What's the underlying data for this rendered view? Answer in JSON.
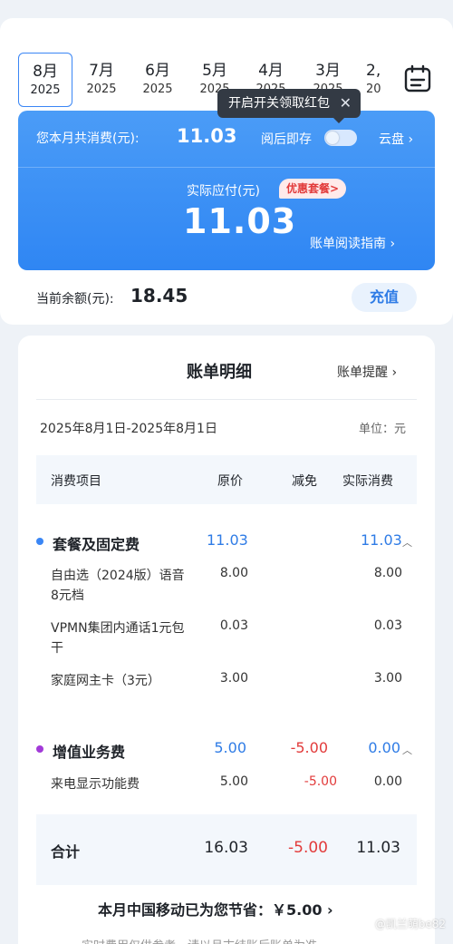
{
  "months": [
    {
      "month": "8月",
      "year": "2025",
      "active": true
    },
    {
      "month": "7月",
      "year": "2025"
    },
    {
      "month": "6月",
      "year": "2025"
    },
    {
      "month": "5月",
      "year": "2025"
    },
    {
      "month": "4月",
      "year": "2025"
    },
    {
      "month": "3月",
      "year": "2025"
    },
    {
      "month": "2,",
      "year": "20"
    }
  ],
  "tooltip": {
    "text": "开启开关领取红包",
    "close": "✕"
  },
  "hero": {
    "month_total_label": "您本月共消费(元):",
    "month_total_value": "11.03",
    "post_read_label": "阅后即存",
    "cloud_label": "云盘 ›",
    "actual_pay_label": "实际应付(元)",
    "promo_badge": "优惠套餐>",
    "actual_pay_value": "11.03",
    "guide_link": "账单阅读指南 ›"
  },
  "balance": {
    "label": "当前余额(元):",
    "value": "18.45",
    "recharge": "充值"
  },
  "detail": {
    "title": "账单明细",
    "remind": "账单提醒 ›",
    "range": "2025年8月1日-2025年8月1日",
    "unit": "单位：元",
    "headers": {
      "item": "消费项目",
      "original": "原价",
      "discount": "减免",
      "actual": "实际消费"
    },
    "groups": [
      {
        "name": "套餐及固定费",
        "original": "11.03",
        "discount": "",
        "actual": "11.03",
        "dot_color": "#3a86f5",
        "items": [
          {
            "name": "自由选（2024版）语音8元档",
            "original": "8.00",
            "discount": "",
            "actual": "8.00"
          },
          {
            "name": "VPMN集团内通话1元包干",
            "original": "0.03",
            "discount": "",
            "actual": "0.03"
          },
          {
            "name": "家庭网主卡（3元）",
            "original": "3.00",
            "discount": "",
            "actual": "3.00"
          }
        ]
      },
      {
        "name": "增值业务费",
        "original": "5.00",
        "discount": "-5.00",
        "actual": "0.00",
        "dot_color": "#a23ad8",
        "items": [
          {
            "name": "来电显示功能费",
            "original": "5.00",
            "discount": "-5.00",
            "actual": "0.00"
          }
        ]
      }
    ],
    "total": {
      "label": "合计",
      "original": "16.03",
      "discount": "-5.00",
      "actual": "11.03"
    },
    "savings": "本月中国移动已为您节省：￥5.00 ›",
    "note": "实时费用仅供参考，请以月末结账后账单为准"
  },
  "colors": {
    "accent": "#2f86f3",
    "red": "#e23b3b",
    "blue_text": "#2f7ce6"
  },
  "watermark": "@凯兰萌be82"
}
